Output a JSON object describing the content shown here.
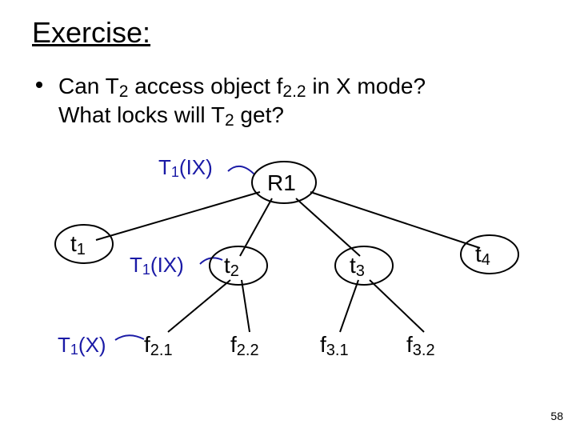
{
  "slide": {
    "title": "Exercise:",
    "bullet_line1_a": "Can T",
    "bullet_line1_b": " access object f",
    "bullet_line1_c": " in X mode?",
    "bullet_line2_a": "What locks will T",
    "bullet_line2_b": " get?",
    "sub2": "2",
    "sub22": "2.2",
    "page": "58"
  },
  "locks": {
    "l1_a": "T",
    "l1_b": "(IX)",
    "l2_a": "T",
    "l2_b": "(IX)",
    "l3_a": "T",
    "l3_b": "(X)",
    "sub1": "1"
  },
  "nodes": {
    "r1": "R1",
    "t1_a": "t",
    "t1_s": "1",
    "t2_a": "t",
    "t2_s": "2",
    "t3_a": "t",
    "t3_s": "3",
    "t4_a": "t",
    "t4_s": "4",
    "f21_a": "f",
    "f21_s": "2.1",
    "f22_a": "f",
    "f22_s": "2.2",
    "f31_a": "f",
    "f31_s": "3.1",
    "f32_a": "f",
    "f32_s": "3.2"
  },
  "chart_data": {
    "type": "tree",
    "root": "R1",
    "children": {
      "R1": [
        "t1",
        "t2",
        "t3",
        "t4"
      ],
      "t2": [
        "f2.1",
        "f2.2"
      ],
      "t3": [
        "f3.1",
        "f3.2"
      ]
    },
    "locks": [
      {
        "txn": "T1",
        "mode": "IX",
        "node": "R1"
      },
      {
        "txn": "T1",
        "mode": "IX",
        "node": "t2"
      },
      {
        "txn": "T1",
        "mode": "X",
        "node": "f2.1"
      }
    ],
    "question": "Can T2 access object f2.2 in X mode? What locks will T2 get?"
  }
}
